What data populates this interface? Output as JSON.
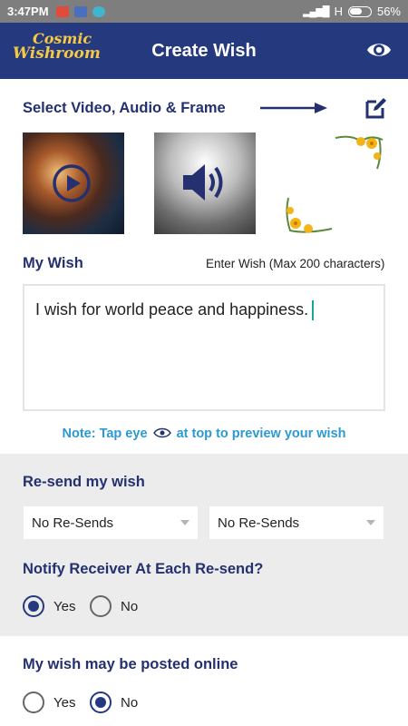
{
  "status_bar": {
    "time": "3:47PM",
    "network": "H",
    "battery": "56%",
    "battery_level": 0.56
  },
  "app_bar": {
    "logo_line1": "Cosmic",
    "logo_line2": "Wishroom",
    "title": "Create Wish",
    "preview_icon": "eye-icon"
  },
  "media": {
    "heading": "Select Video, Audio & Frame",
    "edit_icon": "edit-icon",
    "video_icon": "play-icon",
    "audio_icon": "speaker-icon"
  },
  "wish": {
    "heading": "My Wish",
    "hint": "Enter Wish (Max 200 characters)",
    "text": "I wish for world peace and happiness.",
    "note_before": "Note: Tap eye",
    "note_after": "at top to preview your wish"
  },
  "resend": {
    "heading": "Re-send my wish",
    "dropdown1": "No Re-Sends",
    "dropdown2": "No Re-Sends"
  },
  "notify": {
    "heading": "Notify Receiver At Each Re-send?",
    "options": [
      "Yes",
      "No"
    ],
    "selected": "Yes"
  },
  "post_online": {
    "heading": "My wish may be posted online",
    "options": [
      "Yes",
      "No"
    ],
    "selected": "No"
  },
  "colors": {
    "primary": "#253a7e",
    "accent": "#2c9ad1",
    "section_bg": "#ececec"
  }
}
